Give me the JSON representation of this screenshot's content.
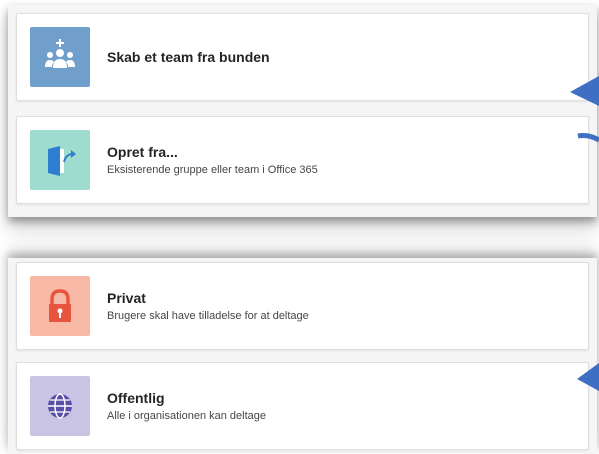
{
  "create_options": [
    {
      "title": "Skab et team fra bunden",
      "description": "",
      "icon": "people-add-icon",
      "tile_color": "#6f9fca"
    },
    {
      "title": "Opret fra...",
      "description": "Eksisterende gruppe eller team i Office 365",
      "icon": "door-arrow-icon",
      "tile_color": "#9fdcd0"
    }
  ],
  "privacy_options": [
    {
      "title": "Privat",
      "description": "Brugere skal have tilladelse for at deltage",
      "icon": "lock-icon",
      "tile_color": "#f7b8a6"
    },
    {
      "title": "Offentlig",
      "description": "Alle i organisationen kan deltage",
      "icon": "globe-icon",
      "tile_color": "#c9c4e3"
    }
  ],
  "annotation_color": "#3f6fc3"
}
